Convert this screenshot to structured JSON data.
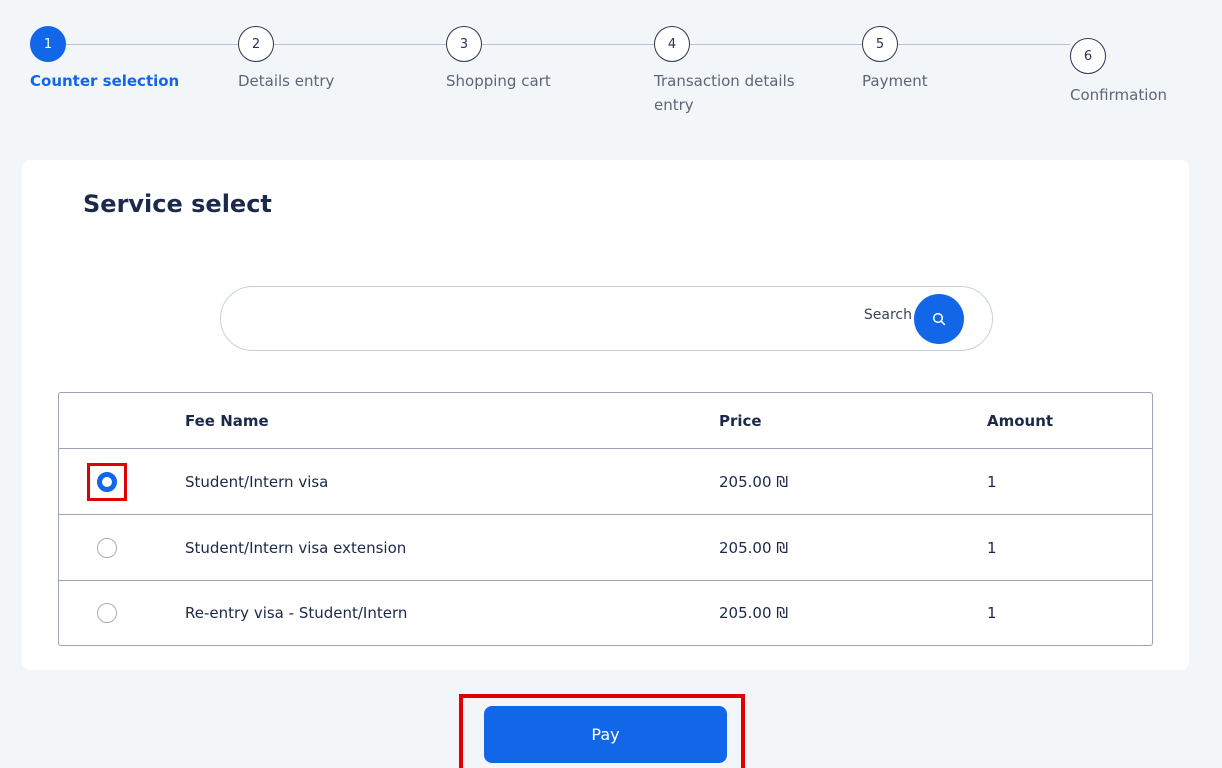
{
  "stepper": {
    "steps": [
      {
        "number": "1",
        "label": "Counter selection"
      },
      {
        "number": "2",
        "label": "Details entry"
      },
      {
        "number": "3",
        "label": "Shopping cart"
      },
      {
        "number": "4",
        "label": "Transaction details entry"
      },
      {
        "number": "5",
        "label": "Payment"
      },
      {
        "number": "6",
        "label": "Confirmation"
      }
    ],
    "active_step": 1
  },
  "service": {
    "title": "Service select",
    "search_label": "Search",
    "search_value": ""
  },
  "table": {
    "headers": {
      "fee_name": "Fee Name",
      "price": "Price",
      "amount": "Amount"
    },
    "rows": [
      {
        "fee_name": "Student/Intern visa",
        "price": "205.00 ₪",
        "amount": "1",
        "selected": true
      },
      {
        "fee_name": "Student/Intern visa extension",
        "price": "205.00 ₪",
        "amount": "1",
        "selected": false
      },
      {
        "fee_name": "Re-entry visa - Student/Intern",
        "price": "205.00 ₪",
        "amount": "1",
        "selected": false
      }
    ]
  },
  "actions": {
    "pay_label": "Pay"
  },
  "colors": {
    "accent": "#1167e8",
    "highlight": "#e00000",
    "background": "#f3f6f9"
  }
}
